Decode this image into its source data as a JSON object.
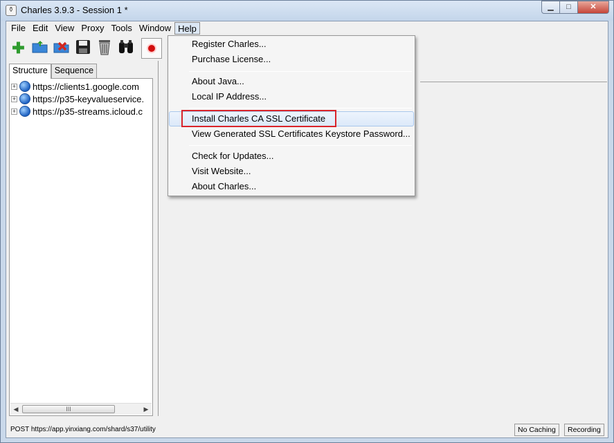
{
  "window": {
    "title": "Charles 3.9.3 - Session 1 *",
    "controls": {
      "minimize": "▁",
      "maximize": "□",
      "close": "✕"
    }
  },
  "menubar": {
    "items": [
      {
        "label": "File"
      },
      {
        "label": "Edit"
      },
      {
        "label": "View"
      },
      {
        "label": "Proxy"
      },
      {
        "label": "Tools"
      },
      {
        "label": "Window"
      },
      {
        "label": "Help",
        "active": true
      }
    ]
  },
  "toolbar": {
    "buttons": [
      {
        "name": "new-session-icon",
        "glyph": "✚",
        "color": "#2e9b2e"
      },
      {
        "name": "open-session-icon",
        "glyph": "📂",
        "color": "#2a72c5"
      },
      {
        "name": "close-session-icon",
        "glyph": "✖",
        "color": "#c4302b"
      },
      {
        "name": "save-icon",
        "glyph": "💾",
        "color": "#333"
      },
      {
        "name": "trash-icon",
        "glyph": "🗑",
        "color": "#555"
      },
      {
        "name": "binoculars-icon",
        "glyph": "⚇",
        "color": "#222"
      }
    ]
  },
  "left_panel": {
    "tabs": [
      {
        "label": "Structure",
        "selected": true
      },
      {
        "label": "Sequence",
        "selected": false
      }
    ],
    "tree": [
      {
        "label": "https://clients1.google.com"
      },
      {
        "label": "https://p35-keyvalueservice."
      },
      {
        "label": "https://p35-streams.icloud.c"
      }
    ],
    "scroll_grip": "III"
  },
  "help_menu": {
    "groups": [
      [
        "Register Charles...",
        "Purchase License..."
      ],
      [
        "About Java...",
        "Local IP Address..."
      ],
      [
        "Install Charles CA SSL Certificate",
        "View Generated SSL Certificates Keystore Password..."
      ],
      [
        "Check for Updates...",
        "Visit Website...",
        "About Charles..."
      ]
    ]
  },
  "status": {
    "text": "POST https://app.yinxiang.com/shard/s37/utility",
    "no_caching": "No Caching",
    "recording": "Recording"
  },
  "colors": {
    "highlight_box": "#d9242a",
    "record_button": "#d20f0f"
  }
}
